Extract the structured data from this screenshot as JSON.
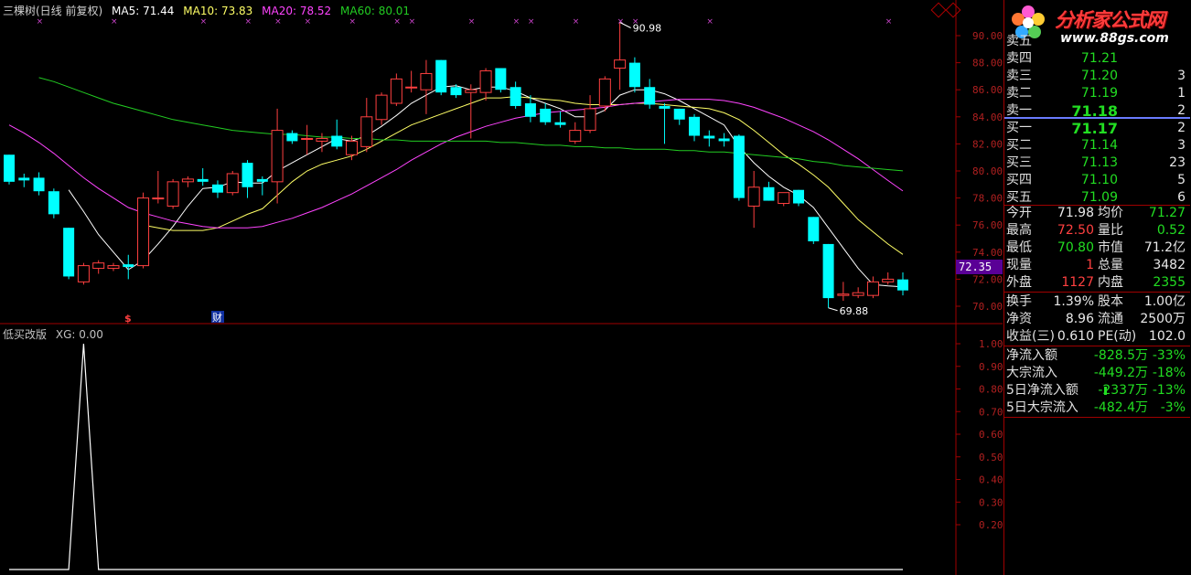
{
  "header": {
    "title": "三棵树(日线 前复权)",
    "ma5": "MA5: 71.44",
    "ma10": "MA10: 73.83",
    "ma20": "MA20: 78.52",
    "ma60": "MA60: 80.01"
  },
  "indicator": {
    "name": "低买改版",
    "xg": "XG: 0.00"
  },
  "annotations": {
    "high": "90.98",
    "low": "69.88",
    "last_price": "72.35",
    "event1": "$",
    "event2": "财"
  },
  "chart_data": [
    {
      "type": "candlestick",
      "title": "三棵树(日线 前复权)",
      "y_ticks": [
        "90.00",
        "88.00",
        "86.00",
        "84.00",
        "82.00",
        "80.00",
        "78.00",
        "76.00",
        "74.00",
        "72.00",
        "70.00"
      ],
      "ylim": [
        69.0,
        91.5
      ],
      "candles": [
        {
          "o": 81.2,
          "h": 81.2,
          "l": 79.0,
          "c": 79.2
        },
        {
          "o": 79.5,
          "h": 79.8,
          "l": 78.8,
          "c": 79.3
        },
        {
          "o": 79.5,
          "h": 79.9,
          "l": 78.2,
          "c": 78.5
        },
        {
          "o": 78.5,
          "h": 78.7,
          "l": 76.5,
          "c": 76.8
        },
        {
          "o": 75.8,
          "h": 75.8,
          "l": 72.0,
          "c": 72.2
        },
        {
          "o": 71.8,
          "h": 73.2,
          "l": 71.6,
          "c": 73.0
        },
        {
          "o": 72.8,
          "h": 73.4,
          "l": 72.4,
          "c": 73.2
        },
        {
          "o": 72.8,
          "h": 73.2,
          "l": 72.6,
          "c": 73.0
        },
        {
          "o": 73.1,
          "h": 73.8,
          "l": 72.0,
          "c": 72.9
        },
        {
          "o": 73.0,
          "h": 78.4,
          "l": 72.8,
          "c": 78.0
        },
        {
          "o": 78.0,
          "h": 80.0,
          "l": 77.6,
          "c": 78.0
        },
        {
          "o": 77.4,
          "h": 79.4,
          "l": 77.2,
          "c": 79.2
        },
        {
          "o": 79.2,
          "h": 79.6,
          "l": 78.8,
          "c": 79.4
        },
        {
          "o": 79.4,
          "h": 80.2,
          "l": 78.9,
          "c": 79.2
        },
        {
          "o": 79.0,
          "h": 79.3,
          "l": 78.0,
          "c": 78.4
        },
        {
          "o": 78.4,
          "h": 80.0,
          "l": 78.2,
          "c": 79.8
        },
        {
          "o": 80.6,
          "h": 80.8,
          "l": 78.0,
          "c": 78.8
        },
        {
          "o": 79.4,
          "h": 79.6,
          "l": 78.2,
          "c": 79.2
        },
        {
          "o": 79.2,
          "h": 84.6,
          "l": 77.6,
          "c": 83.0
        },
        {
          "o": 82.8,
          "h": 83.0,
          "l": 82.0,
          "c": 82.2
        },
        {
          "o": 82.4,
          "h": 83.4,
          "l": 81.2,
          "c": 82.4
        },
        {
          "o": 82.2,
          "h": 82.8,
          "l": 81.4,
          "c": 82.4
        },
        {
          "o": 82.6,
          "h": 83.8,
          "l": 81.6,
          "c": 81.8
        },
        {
          "o": 81.2,
          "h": 82.6,
          "l": 80.8,
          "c": 82.2
        },
        {
          "o": 81.8,
          "h": 85.4,
          "l": 81.4,
          "c": 84.0
        },
        {
          "o": 83.8,
          "h": 85.8,
          "l": 83.4,
          "c": 85.6
        },
        {
          "o": 85.0,
          "h": 87.2,
          "l": 84.8,
          "c": 86.8
        },
        {
          "o": 86.2,
          "h": 87.4,
          "l": 85.8,
          "c": 86.2
        },
        {
          "o": 86.0,
          "h": 88.2,
          "l": 84.2,
          "c": 87.2
        },
        {
          "o": 88.2,
          "h": 88.2,
          "l": 85.6,
          "c": 85.8
        },
        {
          "o": 86.2,
          "h": 86.4,
          "l": 85.4,
          "c": 85.6
        },
        {
          "o": 85.8,
          "h": 86.4,
          "l": 82.4,
          "c": 86.0
        },
        {
          "o": 85.8,
          "h": 87.6,
          "l": 85.2,
          "c": 87.4
        },
        {
          "o": 87.6,
          "h": 87.6,
          "l": 85.8,
          "c": 86.0
        },
        {
          "o": 86.2,
          "h": 86.6,
          "l": 84.6,
          "c": 84.8
        },
        {
          "o": 85.0,
          "h": 85.6,
          "l": 83.6,
          "c": 84.0
        },
        {
          "o": 84.6,
          "h": 85.0,
          "l": 83.4,
          "c": 83.6
        },
        {
          "o": 83.6,
          "h": 84.4,
          "l": 83.2,
          "c": 83.4
        },
        {
          "o": 82.2,
          "h": 83.6,
          "l": 82.0,
          "c": 83.0
        },
        {
          "o": 83.0,
          "h": 85.6,
          "l": 82.8,
          "c": 84.6
        },
        {
          "o": 84.8,
          "h": 87.0,
          "l": 84.4,
          "c": 86.8
        },
        {
          "o": 87.6,
          "h": 90.98,
          "l": 86.0,
          "c": 88.2
        },
        {
          "o": 88.0,
          "h": 88.4,
          "l": 85.8,
          "c": 86.2
        },
        {
          "o": 86.2,
          "h": 86.8,
          "l": 84.6,
          "c": 84.9
        },
        {
          "o": 84.8,
          "h": 85.0,
          "l": 82.0,
          "c": 84.6
        },
        {
          "o": 84.6,
          "h": 84.6,
          "l": 83.4,
          "c": 83.8
        },
        {
          "o": 84.0,
          "h": 84.2,
          "l": 82.2,
          "c": 82.6
        },
        {
          "o": 82.6,
          "h": 83.0,
          "l": 81.8,
          "c": 82.4
        },
        {
          "o": 82.4,
          "h": 82.8,
          "l": 81.8,
          "c": 82.2
        },
        {
          "o": 82.6,
          "h": 82.7,
          "l": 77.8,
          "c": 78.0
        },
        {
          "o": 77.4,
          "h": 80.0,
          "l": 75.8,
          "c": 78.8
        },
        {
          "o": 78.8,
          "h": 79.2,
          "l": 77.8,
          "c": 77.8
        },
        {
          "o": 77.6,
          "h": 78.4,
          "l": 77.4,
          "c": 78.4
        },
        {
          "o": 78.6,
          "h": 78.6,
          "l": 77.4,
          "c": 77.6
        },
        {
          "o": 76.6,
          "h": 76.6,
          "l": 74.6,
          "c": 74.8
        },
        {
          "o": 74.6,
          "h": 74.6,
          "l": 69.88,
          "c": 70.6
        },
        {
          "o": 70.8,
          "h": 71.8,
          "l": 70.4,
          "c": 70.9
        },
        {
          "o": 70.8,
          "h": 71.4,
          "l": 70.6,
          "c": 71.0
        },
        {
          "o": 70.8,
          "h": 72.2,
          "l": 70.6,
          "c": 71.8
        },
        {
          "o": 71.8,
          "h": 72.5,
          "l": 71.6,
          "c": 72.0
        },
        {
          "o": 71.98,
          "h": 72.5,
          "l": 70.8,
          "c": 71.17
        }
      ],
      "ma": [
        {
          "name": "MA5",
          "color": "#ffffff",
          "values": [
            null,
            null,
            null,
            null,
            78.6,
            77.0,
            75.3,
            74.0,
            72.7,
            73.4,
            74.6,
            75.9,
            77.4,
            78.7,
            78.8,
            79.2,
            79.1,
            79.1,
            80.0,
            80.6,
            81.2,
            81.8,
            82.4,
            82.2,
            82.6,
            83.3,
            84.1,
            85.0,
            85.6,
            86.2,
            86.3,
            86.0,
            86.2,
            86.2,
            85.9,
            85.4,
            85.0,
            84.6,
            84.0,
            84.0,
            84.5,
            85.6,
            86.0,
            86.0,
            85.7,
            85.2,
            84.6,
            84.0,
            83.4,
            81.8,
            80.6,
            79.6,
            78.8,
            78.2,
            77.3,
            75.8,
            74.3,
            72.8,
            71.6,
            71.5,
            71.44
          ]
        },
        {
          "name": "MA10",
          "color": "#ffff66",
          "values": [
            null,
            null,
            null,
            null,
            null,
            null,
            null,
            null,
            null,
            76.0,
            75.8,
            75.6,
            75.6,
            75.6,
            75.8,
            76.3,
            76.8,
            77.2,
            78.2,
            79.2,
            80.0,
            80.5,
            80.8,
            81.1,
            81.6,
            82.2,
            82.8,
            83.4,
            83.8,
            84.2,
            84.6,
            85.0,
            85.4,
            85.4,
            85.5,
            85.4,
            85.3,
            85.2,
            85.0,
            84.9,
            84.9,
            84.9,
            85.0,
            85.0,
            84.9,
            84.8,
            84.7,
            84.6,
            84.3,
            83.8,
            83.0,
            82.1,
            81.2,
            80.5,
            79.7,
            78.8,
            77.6,
            76.4,
            75.5,
            74.6,
            73.83
          ]
        },
        {
          "name": "MA20",
          "color": "#ff44ff",
          "values": [
            83.4,
            82.8,
            82.1,
            81.3,
            80.4,
            79.5,
            78.7,
            78.0,
            77.3,
            76.9,
            76.6,
            76.3,
            76.1,
            75.9,
            75.8,
            75.8,
            75.8,
            75.9,
            76.2,
            76.5,
            76.9,
            77.3,
            77.8,
            78.3,
            78.9,
            79.5,
            80.1,
            80.8,
            81.4,
            82.0,
            82.5,
            82.9,
            83.3,
            83.6,
            83.9,
            84.1,
            84.3,
            84.4,
            84.5,
            84.6,
            84.7,
            84.9,
            85.0,
            85.1,
            85.2,
            85.3,
            85.3,
            85.3,
            85.2,
            85.0,
            84.7,
            84.3,
            83.9,
            83.4,
            82.9,
            82.3,
            81.6,
            80.9,
            80.1,
            79.3,
            78.52
          ]
        },
        {
          "name": "MA60",
          "color": "#22cc22",
          "values": [
            null,
            null,
            86.9,
            86.6,
            86.2,
            85.8,
            85.4,
            85.0,
            84.7,
            84.4,
            84.1,
            83.8,
            83.6,
            83.4,
            83.2,
            83.0,
            82.9,
            82.8,
            82.7,
            82.7,
            82.6,
            82.5,
            82.5,
            82.4,
            82.4,
            82.3,
            82.3,
            82.2,
            82.2,
            82.2,
            82.2,
            82.2,
            82.2,
            82.1,
            82.1,
            82.0,
            81.9,
            81.9,
            81.8,
            81.8,
            81.7,
            81.7,
            81.6,
            81.6,
            81.6,
            81.5,
            81.5,
            81.4,
            81.4,
            81.3,
            81.2,
            81.1,
            81.0,
            80.9,
            80.7,
            80.6,
            80.4,
            80.3,
            80.2,
            80.1,
            80.01
          ]
        }
      ]
    },
    {
      "type": "line",
      "title": "低买改版",
      "series_label": "XG",
      "y_ticks": [
        "1.00",
        "0.90",
        "0.80",
        "0.70",
        "0.60",
        "0.50",
        "0.40",
        "0.30",
        "0.20"
      ],
      "ylim": [
        -0.02,
        1.02
      ],
      "values": [
        0,
        0,
        0,
        0,
        0,
        1,
        0,
        0,
        0,
        0,
        0,
        0,
        0,
        0,
        0,
        0,
        0,
        0,
        0,
        0,
        0,
        0,
        0,
        0,
        0,
        0,
        0,
        0,
        0,
        0,
        0,
        0,
        0,
        0,
        0,
        0,
        0,
        0,
        0,
        0,
        0,
        0,
        0,
        0,
        0,
        0,
        0,
        0,
        0,
        0,
        0,
        0,
        0,
        0,
        0,
        0,
        0,
        0,
        0,
        0,
        0
      ]
    }
  ],
  "quote_panel": {
    "brand": "分析家公式网",
    "url": "www.88gs.com",
    "asks": [
      {
        "label": "卖五",
        "price": "",
        "vol": ""
      },
      {
        "label": "卖四",
        "price": "71.21",
        "vol": ""
      },
      {
        "label": "卖三",
        "price": "71.20",
        "vol": "3"
      },
      {
        "label": "卖二",
        "price": "71.19",
        "vol": "1"
      },
      {
        "label": "卖一",
        "price": "71.18",
        "vol": "2"
      }
    ],
    "bids": [
      {
        "label": "买一",
        "price": "71.17",
        "vol": "2"
      },
      {
        "label": "买二",
        "price": "71.14",
        "vol": "3"
      },
      {
        "label": "买三",
        "price": "71.13",
        "vol": "23"
      },
      {
        "label": "买四",
        "price": "71.10",
        "vol": "5"
      },
      {
        "label": "买五",
        "price": "71.09",
        "vol": "6"
      }
    ],
    "stats": [
      {
        "l1": "今开",
        "v1": "71.98",
        "c1": "w",
        "l2": "均价",
        "v2": "71.27",
        "c2": "g"
      },
      {
        "l1": "最高",
        "v1": "72.50",
        "c1": "r",
        "l2": "量比",
        "v2": "0.52",
        "c2": "g"
      },
      {
        "l1": "最低",
        "v1": "70.80",
        "c1": "g",
        "l2": "市值",
        "v2": "71.2亿",
        "c2": "w"
      },
      {
        "l1": "现量",
        "v1": "1",
        "c1": "r",
        "l2": "总量",
        "v2": "3482",
        "c2": "w"
      },
      {
        "l1": "外盘",
        "v1": "1127",
        "c1": "r",
        "l2": "内盘",
        "v2": "2355",
        "c2": "g"
      }
    ],
    "stats2": [
      {
        "l1": "换手",
        "v1": "1.39%",
        "c1": "w",
        "l2": "股本",
        "v2": "1.00亿",
        "c2": "w"
      },
      {
        "l1": "净资",
        "v1": "8.96",
        "c1": "w",
        "l2": "流通",
        "v2": "2500万",
        "c2": "w"
      },
      {
        "l1": "收益(三)",
        "v1": "0.610",
        "c1": "w",
        "l2": "PE(动)",
        "v2": "102.0",
        "c2": "w"
      }
    ],
    "flows": [
      {
        "label": "净流入额",
        "value": "-828.5万",
        "pct": "-33%"
      },
      {
        "label": "大宗流入",
        "value": "-449.2万",
        "pct": "-18%"
      },
      {
        "label": "5日净流入额",
        "value": "-2337万",
        "pct": "-13%"
      },
      {
        "label": "5日大宗流入",
        "value": "-482.4万",
        "pct": "-3%"
      }
    ]
  },
  "colors": {
    "up": "#ff4040",
    "down": "#00ffff",
    "grid": "#a00000",
    "axis_text": "#b02020",
    "marker": "#cc44cc"
  }
}
